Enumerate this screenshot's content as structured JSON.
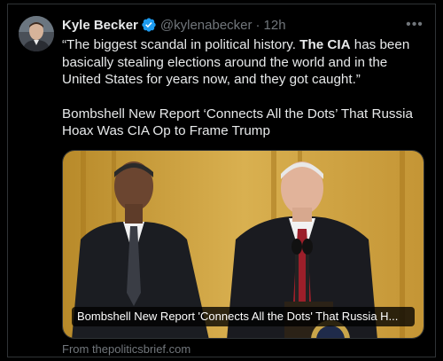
{
  "tweet": {
    "author_name": "Kyle Becker",
    "handle": "@kylenabecker",
    "separator": "·",
    "time": "12h",
    "more_label": "•••",
    "verified_color": "#1d9bf0",
    "text": {
      "quote_open": "“The biggest scandal in political history. ",
      "quote_bold": "The CIA",
      "quote_rest": " has been basically stealing elections around the world and in the United States for years now, and they got caught.”",
      "headline": "Bombshell New Report ‘Connects All the Dots’ That Russia Hoax Was CIA Op to Frame Trump"
    },
    "card": {
      "title": "Bombshell New Report 'Connects All the Dots' That Russia H...",
      "source": "From thepoliticsbrief.com"
    }
  }
}
